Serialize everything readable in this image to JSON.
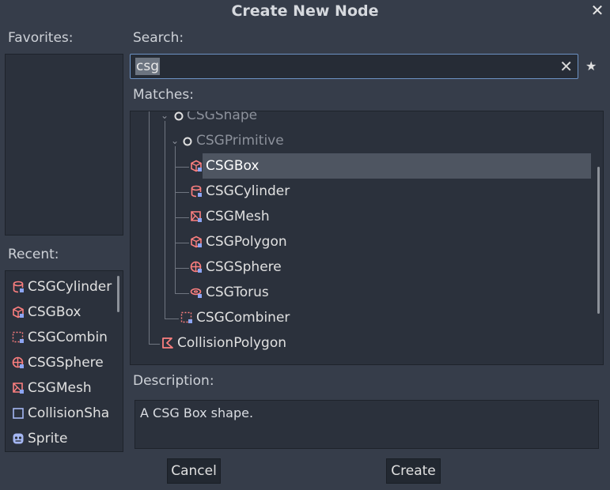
{
  "dialog": {
    "title": "Create New Node",
    "close_icon": "close-icon"
  },
  "favorites": {
    "label": "Favorites:"
  },
  "recent": {
    "label": "Recent:",
    "items": [
      {
        "label": "CSGCylinder",
        "icon": "csg-cylinder-icon"
      },
      {
        "label": "CSGBox",
        "icon": "csg-box-icon"
      },
      {
        "label": "CSGCombin",
        "icon": "csg-combiner-icon"
      },
      {
        "label": "CSGSphere",
        "icon": "csg-sphere-icon"
      },
      {
        "label": "CSGMesh",
        "icon": "csg-mesh-icon"
      },
      {
        "label": "CollisionSha",
        "icon": "collision-shape-icon"
      },
      {
        "label": "Sprite",
        "icon": "sprite-icon"
      }
    ]
  },
  "search": {
    "label": "Search:",
    "value": "csg"
  },
  "matches": {
    "label": "Matches:",
    "items": [
      {
        "label": "CSGShape",
        "dim": true
      },
      {
        "label": "CSGPrimitive",
        "dim": true
      },
      {
        "label": "CSGBox",
        "selected": true
      },
      {
        "label": "CSGCylinder"
      },
      {
        "label": "CSGMesh"
      },
      {
        "label": "CSGPolygon"
      },
      {
        "label": "CSGSphere"
      },
      {
        "label": "CSGTorus"
      },
      {
        "label": "CSGCombiner"
      },
      {
        "label": "CollisionPolygon"
      }
    ]
  },
  "description": {
    "label": "Description:",
    "text": "A CSG Box shape."
  },
  "buttons": {
    "cancel": "Cancel",
    "create": "Create"
  },
  "colors": {
    "background": "#363d4a",
    "panel": "#2b313c",
    "csg_icon": "#fc7f7f",
    "accent_blue": "#6d92c4",
    "selection": "#4e5561"
  }
}
